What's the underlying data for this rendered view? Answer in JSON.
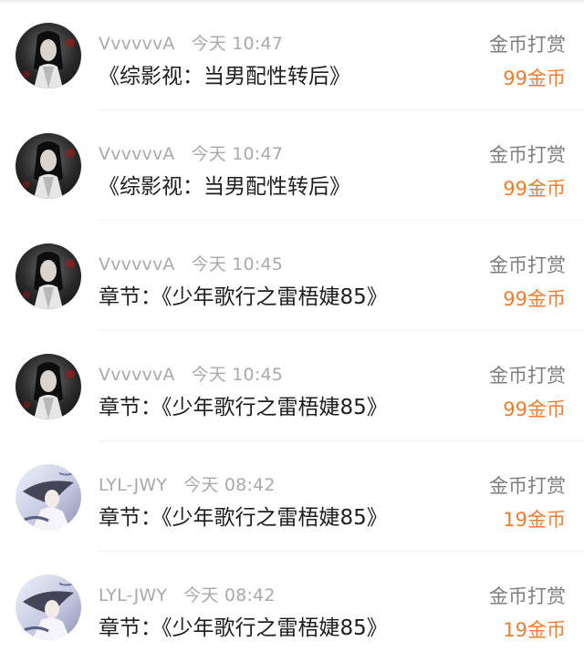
{
  "records": [
    {
      "user": "VvvvvvA",
      "time": "今天 10:47",
      "title": "《综影视：当男配性转后》",
      "type": "金币打赏",
      "amount": "99金币",
      "avatar": "dark-ink-avatar"
    },
    {
      "user": "VvvvvvA",
      "time": "今天 10:47",
      "title": "《综影视：当男配性转后》",
      "type": "金币打赏",
      "amount": "99金币",
      "avatar": "dark-ink-avatar"
    },
    {
      "user": "VvvvvvA",
      "time": "今天 10:45",
      "title": "章节：《少年歌行之雷梧婕85》",
      "type": "金币打赏",
      "amount": "99金币",
      "avatar": "dark-ink-avatar"
    },
    {
      "user": "VvvvvvA",
      "time": "今天 10:45",
      "title": "章节：《少年歌行之雷梧婕85》",
      "type": "金币打赏",
      "amount": "99金币",
      "avatar": "dark-ink-avatar"
    },
    {
      "user": "LYL-JWY",
      "time": "今天 08:42",
      "title": "章节：《少年歌行之雷梧婕85》",
      "type": "金币打赏",
      "amount": "19金币",
      "avatar": "light-ink-avatar"
    },
    {
      "user": "LYL-JWY",
      "time": "今天 08:42",
      "title": "章节：《少年歌行之雷梧婕85》",
      "type": "金币打赏",
      "amount": "19金币",
      "avatar": "light-ink-avatar"
    }
  ],
  "colors": {
    "amount": "#f07c2d",
    "meta": "#a9a9a9",
    "title": "#1e1e1e",
    "type": "#7d7d7d"
  }
}
